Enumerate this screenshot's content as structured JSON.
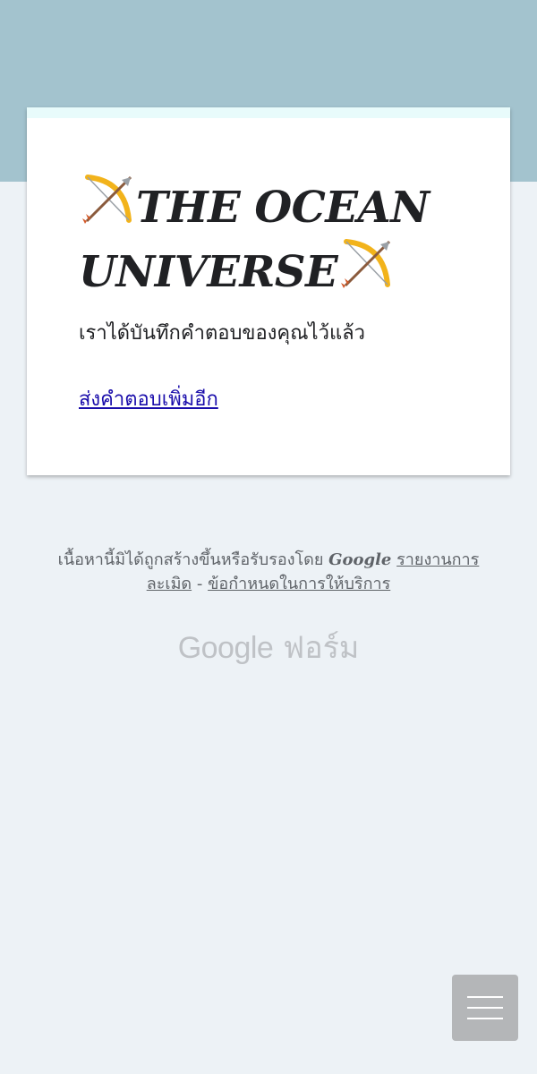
{
  "form": {
    "title_line1": "THE OCEAN",
    "title_line2": "UNIVERSE",
    "title_icon": "bow-and-arrow-icon",
    "confirmation_message": "เราได้บันทึกคำตอบของคุณไว้แล้ว",
    "submit_another_link": "ส่งคำตอบเพิ่มอีก"
  },
  "footer": {
    "disclaimer_prefix": "เนื้อหานี้มิได้ถูกสร้างขึ้นหรือรับรองโดย",
    "brand": "Google",
    "report_abuse": "รายงานการละเมิด",
    "separator": "-",
    "terms": "ข้อกำหนดในการให้บริการ"
  },
  "logo": {
    "google": "Google",
    "product": "ฟอร์ม"
  },
  "colors": {
    "top_band": "#a3c3ce",
    "page_background": "#edf2f6",
    "link": "#1a0dab"
  },
  "menu_button": {
    "icon": "hamburger-menu-icon"
  }
}
